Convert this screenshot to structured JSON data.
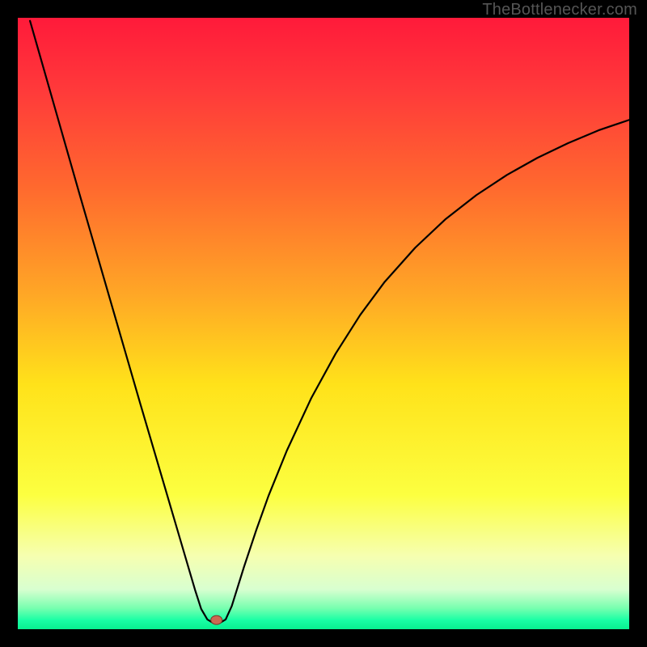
{
  "watermark": "TheBottlenecker.com",
  "chart_data": {
    "type": "line",
    "title": "",
    "xlabel": "",
    "ylabel": "",
    "xlim": [
      0,
      100
    ],
    "ylim": [
      0,
      100
    ],
    "grid": false,
    "background_gradient": {
      "stops": [
        {
          "offset": 0.0,
          "color": "#ff1a3a"
        },
        {
          "offset": 0.12,
          "color": "#ff3a3a"
        },
        {
          "offset": 0.28,
          "color": "#ff6a2e"
        },
        {
          "offset": 0.45,
          "color": "#ffa626"
        },
        {
          "offset": 0.6,
          "color": "#ffe21a"
        },
        {
          "offset": 0.78,
          "color": "#fcff40"
        },
        {
          "offset": 0.88,
          "color": "#f6ffb0"
        },
        {
          "offset": 0.935,
          "color": "#d8ffd0"
        },
        {
          "offset": 0.965,
          "color": "#7affb0"
        },
        {
          "offset": 0.985,
          "color": "#1affa5"
        },
        {
          "offset": 1.0,
          "color": "#08f090"
        }
      ]
    },
    "series": [
      {
        "name": "bottleneck-curve",
        "color": "#000000",
        "stroke_width": 2.2,
        "x": [
          2.0,
          4.0,
          6.0,
          8.0,
          10.0,
          12.0,
          14.0,
          16.0,
          18.0,
          20.0,
          22.0,
          24.0,
          26.0,
          28.0,
          29.0,
          30.0,
          31.0,
          32.0,
          33.0,
          34.0,
          35.0,
          37.0,
          39.0,
          41.0,
          44.0,
          48.0,
          52.0,
          56.0,
          60.0,
          65.0,
          70.0,
          75.0,
          80.0,
          85.0,
          90.0,
          95.0,
          100.0
        ],
        "y": [
          99.5,
          92.5,
          85.5,
          78.5,
          71.5,
          64.6,
          57.7,
          50.8,
          43.9,
          37.0,
          30.2,
          23.4,
          16.6,
          9.8,
          6.4,
          3.3,
          1.6,
          1.0,
          1.0,
          1.6,
          3.8,
          10.2,
          16.2,
          21.8,
          29.2,
          37.8,
          45.1,
          51.4,
          56.8,
          62.4,
          67.1,
          71.0,
          74.3,
          77.1,
          79.5,
          81.6,
          83.3
        ]
      }
    ],
    "marker": {
      "name": "optimal-point",
      "x": 32.5,
      "y": 1.5,
      "rx": 7,
      "ry": 5.5,
      "fill": "#cc6a52",
      "stroke": "#7a3a2a"
    }
  }
}
